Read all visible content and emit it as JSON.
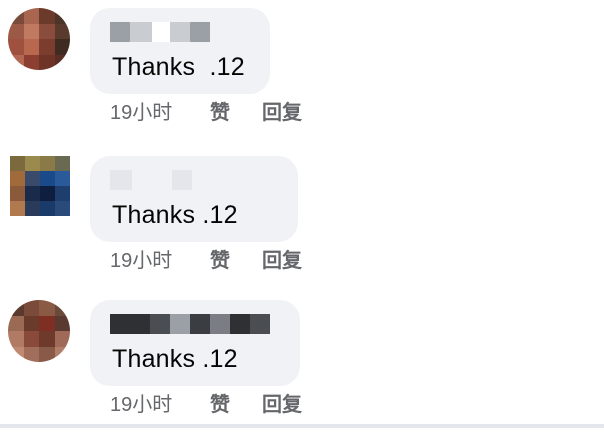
{
  "comments": [
    {
      "text": "Thanks  .12",
      "time": "19小时",
      "like_label": "赞",
      "reply_label": "回复",
      "avatar_colors": [
        "#7a4a3a",
        "#a8654f",
        "#6b3a2a",
        "#4a3526",
        "#9c5a46",
        "#c07a62",
        "#8a4c3c",
        "#5a3a2c",
        "#a0503e",
        "#b8684f",
        "#7c3c2e",
        "#3e2c22",
        "#b26852",
        "#8c3e30",
        "#6e3428",
        "#5a2e24"
      ],
      "name_mask_colors": [
        "#9aa0a6",
        "#c9ccd1",
        "#ffffff",
        "#c9ccd1",
        "#9aa0a6"
      ]
    },
    {
      "text": "Thanks .12",
      "time": "19小时",
      "like_label": "赞",
      "reply_label": "回复",
      "avatar_colors": [
        "#7a6a3e",
        "#9a8a4e",
        "#8a7a48",
        "#6a6a52",
        "#a06a3a",
        "#3a4a6a",
        "#1a4a8a",
        "#2a5a9a",
        "#8a5a3a",
        "#1a2a4a",
        "#0e1e3e",
        "#1e3e6e",
        "#b07a4e",
        "#2a3a5a",
        "#1a3a6a",
        "#2a4a7a"
      ],
      "name_mask_colors": [
        "#e4e6eb",
        "#f0f2f5",
        "#e4e6eb"
      ]
    },
    {
      "text": "Thanks .12",
      "time": "19小时",
      "like_label": "赞",
      "reply_label": "回复",
      "avatar_colors": [
        "#5a3a2e",
        "#7a4a3a",
        "#8a5a44",
        "#6a4a3a",
        "#9a6a54",
        "#6a3a2a",
        "#7e2e22",
        "#5a3a30",
        "#b07a64",
        "#8a4a3a",
        "#6e3a2c",
        "#a06a58",
        "#c08a72",
        "#a06e5a",
        "#8a5a48",
        "#b07e68"
      ],
      "name_mask_colors": [
        "#2e3034",
        "#4a4d52",
        "#9aa0a6",
        "#3a3d42",
        "#7a7e84",
        "#2e3034",
        "#4a4d52"
      ]
    }
  ]
}
